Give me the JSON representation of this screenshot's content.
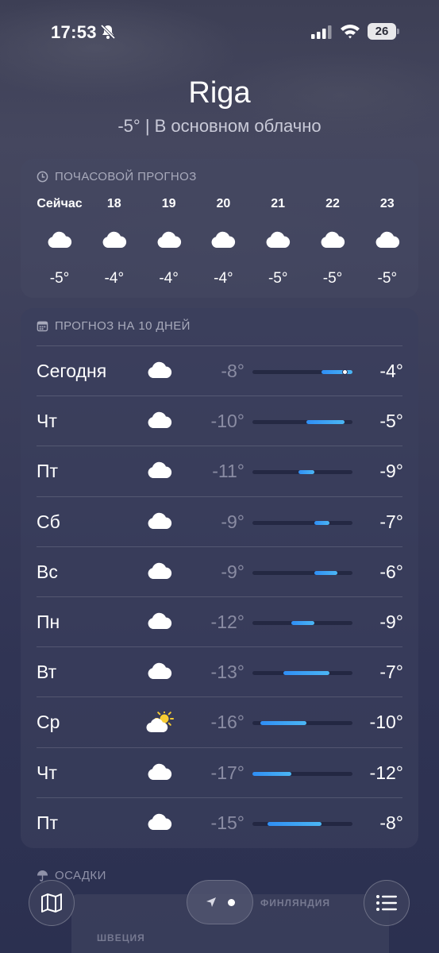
{
  "status": {
    "time": "17:53",
    "battery": "26"
  },
  "header": {
    "city": "Riga",
    "summary": "-5°  |  В основном облачно"
  },
  "hourly": {
    "title": "ПОЧАСОВОЙ ПРОГНОЗ",
    "items": [
      {
        "label": "Сейчас",
        "icon": "cloud-icon",
        "temp": "-5°"
      },
      {
        "label": "18",
        "icon": "cloud-icon",
        "temp": "-4°"
      },
      {
        "label": "19",
        "icon": "cloud-icon",
        "temp": "-4°"
      },
      {
        "label": "20",
        "icon": "cloud-icon",
        "temp": "-4°"
      },
      {
        "label": "21",
        "icon": "cloud-icon",
        "temp": "-5°"
      },
      {
        "label": "22",
        "icon": "cloud-icon",
        "temp": "-5°"
      },
      {
        "label": "23",
        "icon": "cloud-icon",
        "temp": "-5°"
      }
    ]
  },
  "daily": {
    "title": "ПРОГНОЗ НА 10 ДНЕЙ",
    "range": {
      "min": -17,
      "max": -4
    },
    "current_temp": -5,
    "days": [
      {
        "name": "Сегодня",
        "icon": "cloud-icon",
        "low": "-8°",
        "high": "-4°",
        "low_val": -8,
        "high_val": -4,
        "is_today": true
      },
      {
        "name": "Чт",
        "icon": "cloud-icon",
        "low": "-10°",
        "high": "-5°",
        "low_val": -10,
        "high_val": -5
      },
      {
        "name": "Пт",
        "icon": "cloud-icon",
        "low": "-11°",
        "high": "-9°",
        "low_val": -11,
        "high_val": -9
      },
      {
        "name": "Сб",
        "icon": "cloud-icon",
        "low": "-9°",
        "high": "-7°",
        "low_val": -9,
        "high_val": -7
      },
      {
        "name": "Вс",
        "icon": "cloud-icon",
        "low": "-9°",
        "high": "-6°",
        "low_val": -9,
        "high_val": -6
      },
      {
        "name": "Пн",
        "icon": "cloud-icon",
        "low": "-12°",
        "high": "-9°",
        "low_val": -12,
        "high_val": -9
      },
      {
        "name": "Вт",
        "icon": "cloud-icon",
        "low": "-13°",
        "high": "-7°",
        "low_val": -13,
        "high_val": -7
      },
      {
        "name": "Ср",
        "icon": "sun-cloud-icon",
        "low": "-16°",
        "high": "-10°",
        "low_val": -16,
        "high_val": -10
      },
      {
        "name": "Чт",
        "icon": "cloud-icon",
        "low": "-17°",
        "high": "-12°",
        "low_val": -17,
        "high_val": -12
      },
      {
        "name": "Пт",
        "icon": "cloud-icon",
        "low": "-15°",
        "high": "-8°",
        "low_val": -15,
        "high_val": -8
      }
    ]
  },
  "precipitation": {
    "title": "ОСАДКИ",
    "map_labels": {
      "finland": "ФИНЛЯНДИЯ",
      "sweden": "ШВЕЦИЯ"
    }
  },
  "nav": {
    "map_icon": "map-icon",
    "list_icon": "list-icon",
    "location_icon": "location-arrow-icon"
  }
}
